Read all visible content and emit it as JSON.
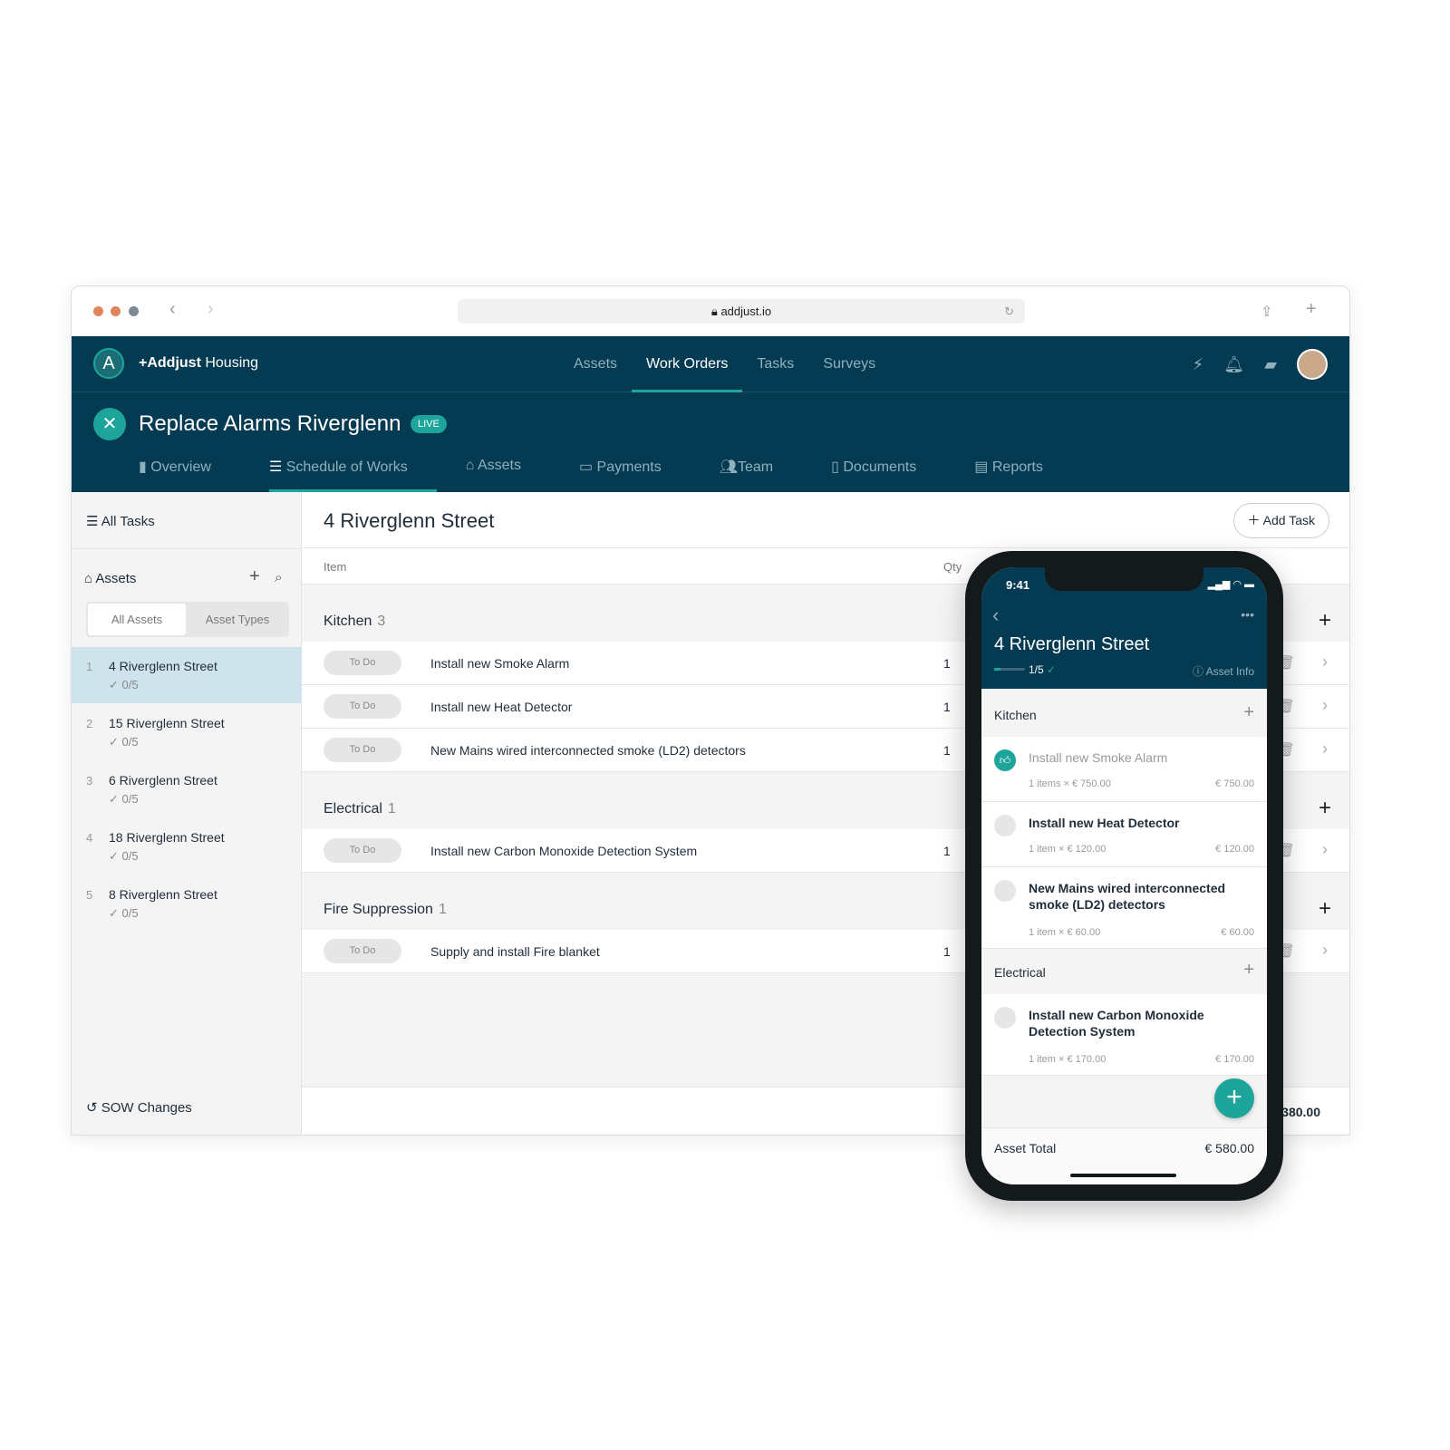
{
  "browser": {
    "url": "addjust.io"
  },
  "app": {
    "brand_bold": "+Addjust",
    "brand_rest": " Housing",
    "nav": [
      "Assets",
      "Work Orders",
      "Tasks",
      "Surveys"
    ],
    "active_nav": "Work Orders"
  },
  "project": {
    "title": "Replace Alarms Riverglenn",
    "status": "LIVE",
    "tabs": [
      "Overview",
      "Schedule of Works",
      "Assets",
      "Payments",
      "Team",
      "Documents",
      "Reports"
    ]
  },
  "sidebar": {
    "all_tasks": "All Tasks",
    "assets_label": "Assets",
    "toggle": [
      "All Assets",
      "Asset Types"
    ],
    "assets": [
      {
        "n": "1",
        "name": "4 Riverglenn Street",
        "progress": "0/5"
      },
      {
        "n": "2",
        "name": "15 Riverglenn Street",
        "progress": "0/5"
      },
      {
        "n": "3",
        "name": "6 Riverglenn Street",
        "progress": "0/5"
      },
      {
        "n": "4",
        "name": "18 Riverglenn Street",
        "progress": "0/5"
      },
      {
        "n": "5",
        "name": "8 Riverglenn Street",
        "progress": "0/5"
      }
    ],
    "sow_changes": "SOW Changes"
  },
  "main": {
    "title": "4 Riverglenn Street",
    "add_task": "Add Task",
    "col_item": "Item",
    "col_qty": "Qty",
    "total": "€ 580.00",
    "total_visible": "380.00",
    "sections": [
      {
        "name": "Kitchen",
        "count": "3",
        "rows": [
          {
            "status": "To Do",
            "item": "Install new Smoke Alarm",
            "qty": "1"
          },
          {
            "status": "To Do",
            "item": "Install new Heat Detector",
            "qty": "1"
          },
          {
            "status": "To Do",
            "item": "New Mains wired interconnected smoke (LD2) detectors",
            "qty": "1"
          }
        ]
      },
      {
        "name": "Electrical",
        "count": "1",
        "rows": [
          {
            "status": "To Do",
            "item": "Install new Carbon Monoxide Detection System",
            "qty": "1"
          }
        ]
      },
      {
        "name": "Fire Suppression",
        "count": "1",
        "rows": [
          {
            "status": "To Do",
            "item": "Supply and install Fire blanket",
            "qty": "1"
          }
        ]
      }
    ]
  },
  "phone": {
    "time": "9:41",
    "title": "4 Riverglenn Street",
    "progress": "1/5",
    "progress_fraction": 0.2,
    "asset_info": "Asset Info",
    "kitchen": "Kitchen",
    "electrical": "Electrical",
    "items": [
      {
        "name": "Install new Smoke Alarm",
        "meta": "1 items × € 750.00",
        "price": "€ 750.00",
        "done": true
      },
      {
        "name": "Install new Heat Detector",
        "meta": "1 item × € 120.00",
        "price": "€ 120.00"
      },
      {
        "name": "New Mains wired interconnected smoke (LD2) detectors",
        "meta": "1 item × € 60.00",
        "price": "€ 60.00"
      },
      {
        "name": "Install new Carbon Monoxide Detection System",
        "meta": "1 item × € 170.00",
        "price": "€ 170.00"
      }
    ],
    "total_label": "Asset Total",
    "total": "€ 580.00"
  },
  "colors": {
    "navy": "#053b52",
    "teal": "#1ea59b"
  }
}
